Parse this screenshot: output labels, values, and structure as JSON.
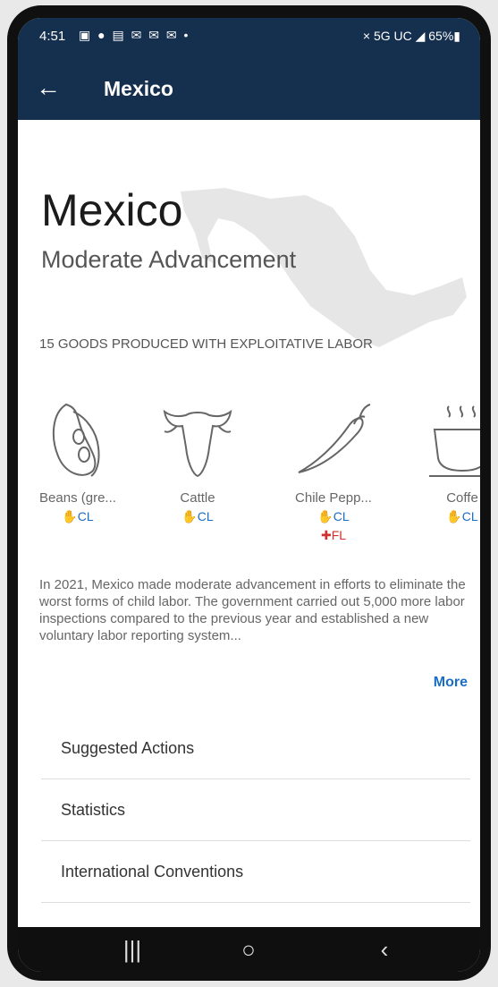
{
  "status_bar": {
    "time": "4:51",
    "notification_icons": "▣ ● ▤ ✉ ✉ ✉ •",
    "right": "× 5G UC ◢ 65%▮"
  },
  "app_bar": {
    "back_glyph": "←",
    "title": "Mexico"
  },
  "country": {
    "name": "Mexico",
    "advancement_level": "Moderate Advancement"
  },
  "goods": {
    "heading": "15 GOODS PRODUCED WITH EXPLOITATIVE LABOR",
    "items": [
      {
        "name": "Beans (gre...",
        "tags": [
          "CL"
        ],
        "icon": "beans-icon"
      },
      {
        "name": "Cattle",
        "tags": [
          "CL"
        ],
        "icon": "cattle-icon"
      },
      {
        "name": "Chile Pepp...",
        "tags": [
          "CL",
          "FL"
        ],
        "icon": "chile-pepper-icon"
      },
      {
        "name": "Coffe",
        "tags": [
          "CL"
        ],
        "icon": "coffee-icon"
      }
    ]
  },
  "summary": {
    "text": "In 2021, Mexico made moderate advancement in efforts to eliminate the worst forms of child labor. The government carried out 5,000 more labor inspections compared to the previous year and established a new voluntary labor reporting system...",
    "more_label": "More"
  },
  "sections": [
    "Suggested Actions",
    "Statistics",
    "International Conventions"
  ],
  "nav_bar": {
    "recents": "|||",
    "home": "○",
    "back": "‹"
  },
  "colors": {
    "header_bg": "#15304f",
    "accent_blue": "#1a6fc4",
    "forced_labor_red": "#d0312d"
  }
}
